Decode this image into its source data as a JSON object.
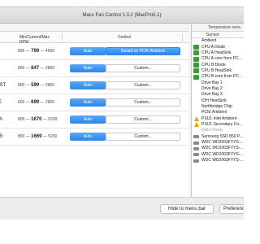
{
  "window": {
    "title": "Macs Fan Control 1.3.2 (MacPro5,1)"
  },
  "fans_table": {
    "header_rpm": "Min/Current/Max RPM",
    "header_control": "Control",
    "rows": [
      {
        "name": "",
        "min": "800",
        "current": "799",
        "max": "4500",
        "auto": "Auto",
        "custom": "Based on PCIE Ambient",
        "custom_active": true
      },
      {
        "name": "",
        "min": "800",
        "current": "847",
        "max": "2800",
        "auto": "Auto",
        "custom": "Custom...",
        "custom_active": false
      },
      {
        "name": "IST",
        "min": "800",
        "current": "599",
        "max": "2800",
        "auto": "Auto",
        "custom": "Custom...",
        "custom_active": false
      },
      {
        "name": "E",
        "min": "600",
        "current": "699",
        "max": "2800",
        "auto": "Auto",
        "custom": "Custom...",
        "custom_active": false
      },
      {
        "name": "'A",
        "min": "800",
        "current": "1670",
        "max": "5200",
        "auto": "Auto",
        "custom": "Custom...",
        "custom_active": false
      },
      {
        "name": "'B",
        "min": "800",
        "current": "1669",
        "max": "5200",
        "auto": "Auto",
        "custom": "Custom...",
        "custom_active": false
      }
    ]
  },
  "sensors": {
    "title": "Temperature sens",
    "header": "Sensor",
    "items": [
      {
        "label": "Ambient",
        "icon": "blank"
      },
      {
        "label": "CPU A Diode",
        "icon": "chip"
      },
      {
        "label": "CPU A HeatSink",
        "icon": "chip"
      },
      {
        "label": "CPU A core from PC...",
        "icon": "chip"
      },
      {
        "label": "CPU B Diode",
        "icon": "chip"
      },
      {
        "label": "CPU B HeatSink",
        "icon": "chip"
      },
      {
        "label": "CPU B core from PC...",
        "icon": "chip"
      },
      {
        "label": "Drive Bay 1",
        "icon": "blank"
      },
      {
        "label": "Drive Bay 2",
        "icon": "blank"
      },
      {
        "label": "Drive Bay 3",
        "icon": "blank"
      },
      {
        "label": "IOH HeatSink",
        "icon": "blank"
      },
      {
        "label": "Northbridge Chip",
        "icon": "blank"
      },
      {
        "label": "PCIE Ambient",
        "icon": "blank"
      },
      {
        "label": "PSU1 Inlet Ambient",
        "icon": "warn"
      },
      {
        "label": "PSU1 Secondary Co...",
        "icon": "warn"
      },
      {
        "label": "Disk Drives:",
        "icon": "group"
      },
      {
        "label": "Samsung SSD 850 P...",
        "icon": "disk"
      },
      {
        "label": "WDC WD2003FYYS-...",
        "icon": "disk"
      },
      {
        "label": "WDC WD2003FYYS-...",
        "icon": "disk"
      },
      {
        "label": "WDC WD2003FYYS-...",
        "icon": "disk"
      },
      {
        "label": "WDC WD2003FYYS-...",
        "icon": "disk"
      }
    ]
  },
  "bottom": {
    "hide_label": "Hide to menu bar",
    "pref_label": "Preferences..."
  }
}
